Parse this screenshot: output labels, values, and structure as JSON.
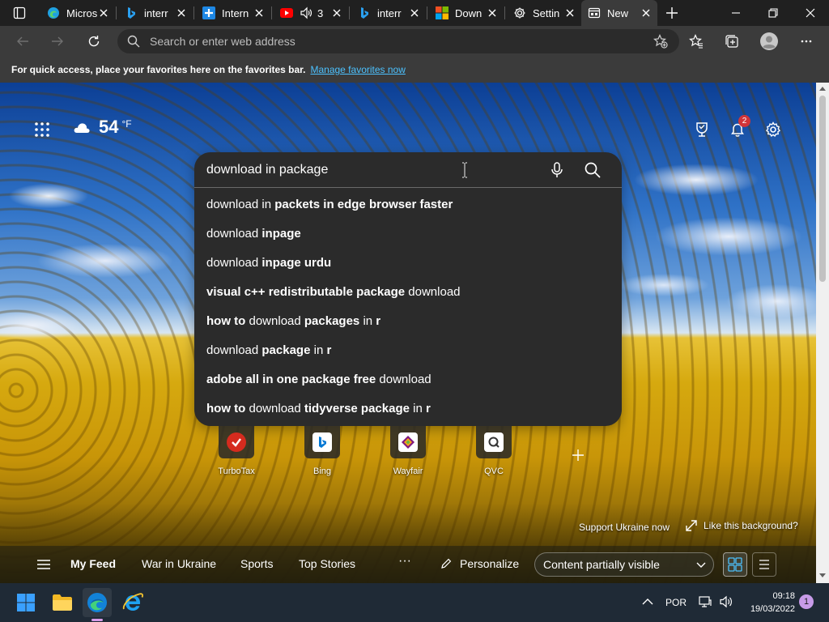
{
  "tabs": [
    {
      "title": "Micros",
      "icon": "edge-icon",
      "active": false
    },
    {
      "title": "interr",
      "icon": "bing-icon",
      "active": false
    },
    {
      "title": "Intern",
      "icon": "plus-square-icon",
      "active": false
    },
    {
      "title": "3",
      "icon": "youtube-icon",
      "active": false,
      "audio": true
    },
    {
      "title": "interr",
      "icon": "bing-icon",
      "active": false
    },
    {
      "title": "Down",
      "icon": "microsoft-icon",
      "active": false
    },
    {
      "title": "Settin",
      "icon": "gear-icon",
      "active": false
    },
    {
      "title": "New",
      "icon": "new-tab-icon",
      "active": true
    }
  ],
  "address_bar": {
    "placeholder": "Search or enter web address"
  },
  "favorites_bar": {
    "message": "For quick access, place your favorites here on the favorites bar.",
    "link": "Manage favorites now"
  },
  "weather": {
    "temperature": "54",
    "unit": "°F",
    "icon": "cloud-icon"
  },
  "notifications": {
    "count": "2"
  },
  "search": {
    "query": "download in package",
    "suggestions": [
      [
        {
          "t": "download in ",
          "b": false
        },
        {
          "t": "packets in edge browser faster",
          "b": true
        }
      ],
      [
        {
          "t": "download ",
          "b": false
        },
        {
          "t": "inpage",
          "b": true
        }
      ],
      [
        {
          "t": "download ",
          "b": false
        },
        {
          "t": "inpage urdu",
          "b": true
        }
      ],
      [
        {
          "t": "visual c++ redistributable package",
          "b": true
        },
        {
          "t": " download",
          "b": false
        }
      ],
      [
        {
          "t": "how to",
          "b": true
        },
        {
          "t": " download ",
          "b": false
        },
        {
          "t": "packages",
          "b": true
        },
        {
          "t": " in ",
          "b": false
        },
        {
          "t": "r",
          "b": true
        }
      ],
      [
        {
          "t": "download ",
          "b": false
        },
        {
          "t": "package",
          "b": true
        },
        {
          "t": " in ",
          "b": false
        },
        {
          "t": "r",
          "b": true
        }
      ],
      [
        {
          "t": "adobe all in one package free",
          "b": true
        },
        {
          "t": " download",
          "b": false
        }
      ],
      [
        {
          "t": "how to",
          "b": true
        },
        {
          "t": " download ",
          "b": false
        },
        {
          "t": "tidyverse package",
          "b": true
        },
        {
          "t": " in ",
          "b": false
        },
        {
          "t": "r",
          "b": true
        }
      ]
    ]
  },
  "quick_links": [
    {
      "label": "TurboTax",
      "icon": "turbotax-icon",
      "color": "#d52b1e"
    },
    {
      "label": "Bing",
      "icon": "bing-icon",
      "color": "#0078d4"
    },
    {
      "label": "Wayfair",
      "icon": "wayfair-icon",
      "color": "#7f187f"
    },
    {
      "label": "QVC",
      "icon": "qvc-icon",
      "color": "#333333"
    }
  ],
  "support_link": "Support Ukraine now",
  "like_background": "Like this background?",
  "feed": {
    "items": [
      "My Feed",
      "War in Ukraine",
      "Sports",
      "Top Stories"
    ],
    "more": "···",
    "personalize": "Personalize",
    "visibility": "Content partially visible"
  },
  "taskbar": {
    "apps": [
      "windows-start-icon",
      "file-explorer-icon",
      "edge-icon",
      "internet-explorer-icon"
    ],
    "language": "POR",
    "time": "09:18",
    "date": "19/03/2022",
    "notification_count": "1"
  },
  "colors": {
    "accent_link": "#4cc2ff",
    "tab_bg": "#202020",
    "toolbar_bg": "#3b3b3b",
    "suggestion_bg": "#2b2b2b",
    "badge": "#d13438"
  }
}
